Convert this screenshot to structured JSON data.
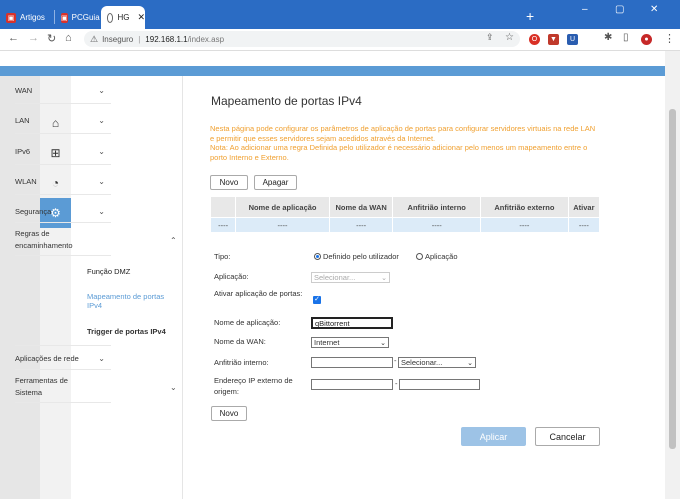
{
  "browser": {
    "tabs": [
      {
        "label": "Artigos"
      },
      {
        "label": "PCGuia"
      },
      {
        "label": "HG"
      }
    ],
    "new_tab": "+",
    "window_controls": {
      "minimize": "–",
      "maximize": "▢",
      "close": "✕"
    },
    "address": {
      "security_label": "Inseguro",
      "host": "192.168.1.1",
      "path": "/index.asp"
    }
  },
  "sidebar_menu": {
    "items": [
      {
        "label": "WAN"
      },
      {
        "label": "LAN"
      },
      {
        "label": "IPv6"
      },
      {
        "label": "WLAN"
      },
      {
        "label": "Segurança"
      },
      {
        "label": "Regras de encaminhamento"
      },
      {
        "label": "Função DMZ"
      },
      {
        "label": "Mapeamento de portas IPv4"
      },
      {
        "label": "Trigger de portas IPv4"
      },
      {
        "label": "Aplicações de rede"
      },
      {
        "label": "Ferramentas de Sistema"
      }
    ]
  },
  "main": {
    "title": "Mapeamento de portas IPv4",
    "description_line1": "Nesta página pode configurar os parâmetros de aplicação de portas para configurar servidores virtuais na rede LAN e permitir que esses servidores sejam acedidos através da Internet.",
    "description_line2": "Nota: Ao adicionar uma regra Definida pelo utilizador é necessário adicionar pelo menos um mapeamento entre o porto Interno e Externo.",
    "btn_new": "Novo",
    "btn_delete": "Apagar",
    "table": {
      "headers": [
        "",
        "Nome de aplicação",
        "Nome da WAN",
        "Anfitrião interno",
        "Anfitrião externo",
        "Ativar"
      ],
      "rows": [
        [
          "----",
          "----",
          "----",
          "----",
          "----",
          "----"
        ]
      ]
    },
    "form": {
      "type_label": "Tipo:",
      "type_option_user": "Definido pelo utilizador",
      "type_option_app": "Aplicação",
      "app_label": "Aplicação:",
      "app_value": "Selecionar...",
      "enable_label": "Ativar aplicação de portas:",
      "app_name_label": "Nome de aplicação:",
      "app_name_value": "qBittorrent",
      "wan_label": "Nome da WAN:",
      "wan_value": "Internet",
      "internal_host_label": "Anfitrião interno:",
      "internal_host_select": "Selecionar...",
      "internal_host_dash": "-",
      "external_ip_label": "Endereço IP externo de origem:",
      "external_ip_dash": "-",
      "btn_new": "Novo"
    },
    "btn_apply": "Aplicar",
    "btn_cancel": "Cancelar"
  },
  "colors": {
    "accent": "#5b9bd5",
    "tabstrip": "#2b6cc4",
    "description": "#f0a030",
    "table_row": "#dcebf8"
  }
}
